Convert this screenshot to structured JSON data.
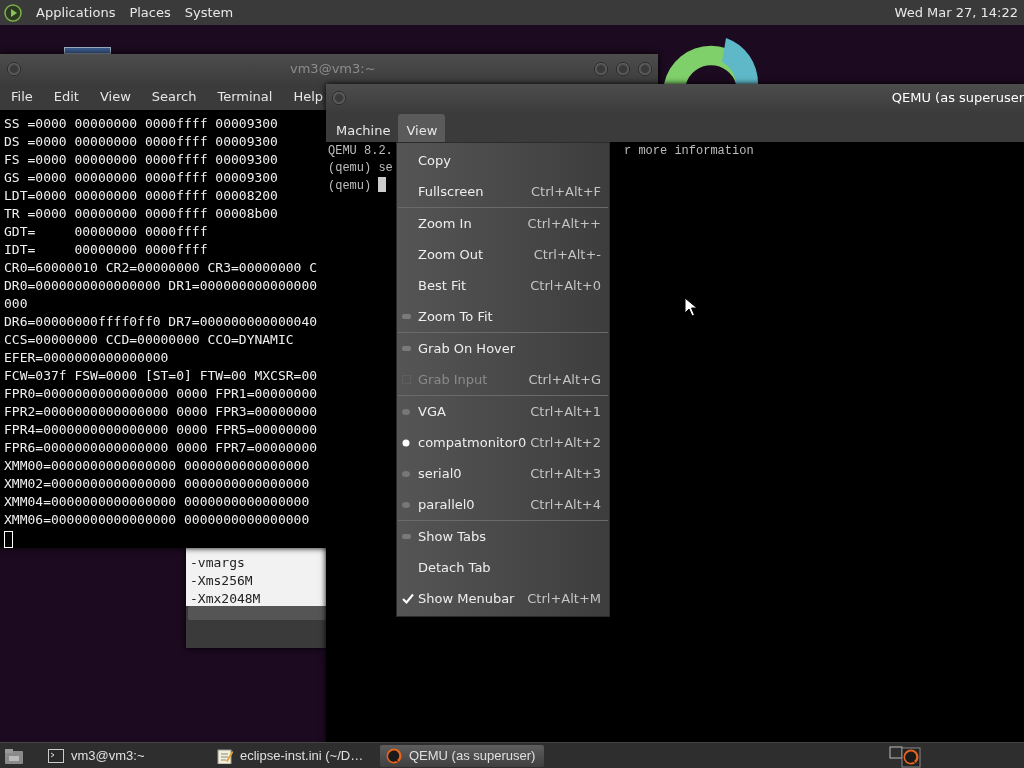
{
  "top_panel": {
    "menus": [
      "Applications",
      "Places",
      "System"
    ],
    "clock": "Wed Mar 27, 14:22"
  },
  "terminal_window": {
    "title": "vm3@vm3:~",
    "menus": [
      "File",
      "Edit",
      "View",
      "Search",
      "Terminal",
      "Help"
    ],
    "lines": [
      "SS =0000 00000000 0000ffff 00009300",
      "DS =0000 00000000 0000ffff 00009300",
      "FS =0000 00000000 0000ffff 00009300",
      "GS =0000 00000000 0000ffff 00009300",
      "LDT=0000 00000000 0000ffff 00008200",
      "TR =0000 00000000 0000ffff 00008b00",
      "GDT=     00000000 0000ffff",
      "IDT=     00000000 0000ffff",
      "CR0=60000010 CR2=00000000 CR3=00000000 C",
      "DR0=0000000000000000 DR1=000000000000000",
      "000",
      "DR6=00000000ffff0ff0 DR7=000000000000040",
      "CCS=00000000 CCD=00000000 CCO=DYNAMIC",
      "EFER=0000000000000000",
      "FCW=037f FSW=0000 [ST=0] FTW=00 MXCSR=00",
      "FPR0=0000000000000000 0000 FPR1=00000000",
      "FPR2=0000000000000000 0000 FPR3=00000000",
      "FPR4=0000000000000000 0000 FPR5=00000000",
      "FPR6=0000000000000000 0000 FPR7=00000000",
      "XMM00=0000000000000000 0000000000000000",
      "XMM02=0000000000000000 0000000000000000",
      "XMM04=0000000000000000 0000000000000000",
      "XMM06=0000000000000000 0000000000000000"
    ]
  },
  "editor_window": {
    "lines": [
      "-vmargs",
      "-Xms256M",
      "-Xmx2048M"
    ]
  },
  "qemu_window": {
    "title": "QEMU (as superuser",
    "menus": [
      {
        "label": "Machine",
        "selected": false
      },
      {
        "label": "View",
        "selected": true
      }
    ],
    "console_lines": [
      {
        "text": "QEMU 8.2.",
        "text_right": "r more information"
      },
      {
        "text": "(qemu) se"
      },
      {
        "text": "(qemu)",
        "cursor": true
      }
    ]
  },
  "view_menu": {
    "items": [
      {
        "kind": "plain",
        "label": "Copy",
        "disabled": false
      },
      {
        "kind": "plain",
        "label": "Fullscreen",
        "shortcut": "Ctrl+Alt+F",
        "disabled": false
      },
      {
        "kind": "separator"
      },
      {
        "kind": "plain",
        "label": "Zoom In",
        "shortcut": "Ctrl+Alt++",
        "disabled": false
      },
      {
        "kind": "plain",
        "label": "Zoom Out",
        "shortcut": "Ctrl+Alt+-",
        "disabled": false
      },
      {
        "kind": "plain",
        "label": "Best Fit",
        "shortcut": "Ctrl+Alt+0",
        "disabled": false
      },
      {
        "kind": "check",
        "label": "Zoom To Fit",
        "checked": false,
        "disabled": false
      },
      {
        "kind": "separator"
      },
      {
        "kind": "check",
        "label": "Grab On Hover",
        "checked": false,
        "disabled": false
      },
      {
        "kind": "check",
        "label": "Grab Input",
        "shortcut": "Ctrl+Alt+G",
        "checked": false,
        "disabled": true
      },
      {
        "kind": "separator"
      },
      {
        "kind": "radio",
        "label": "VGA",
        "shortcut": "Ctrl+Alt+1",
        "selected": false,
        "disabled": false
      },
      {
        "kind": "radio",
        "label": "compatmonitor0",
        "shortcut": "Ctrl+Alt+2",
        "selected": true,
        "disabled": false
      },
      {
        "kind": "radio",
        "label": "serial0",
        "shortcut": "Ctrl+Alt+3",
        "selected": false,
        "disabled": false
      },
      {
        "kind": "radio",
        "label": "parallel0",
        "shortcut": "Ctrl+Alt+4",
        "selected": false,
        "disabled": false
      },
      {
        "kind": "separator"
      },
      {
        "kind": "check",
        "label": "Show Tabs",
        "checked": false,
        "disabled": false
      },
      {
        "kind": "plain",
        "label": "Detach Tab",
        "disabled": false
      },
      {
        "kind": "check",
        "label": "Show Menubar",
        "shortcut": "Ctrl+Alt+M",
        "checked": true,
        "disabled": false
      }
    ]
  },
  "taskbar": {
    "buttons": [
      {
        "kind": "terminal",
        "label": "vm3@vm3:~",
        "selected": false
      },
      {
        "kind": "editor",
        "label": "eclipse-inst.ini (~/D…",
        "selected": false
      },
      {
        "kind": "emulator",
        "label": "QEMU (as superuser)",
        "selected": true
      }
    ]
  }
}
